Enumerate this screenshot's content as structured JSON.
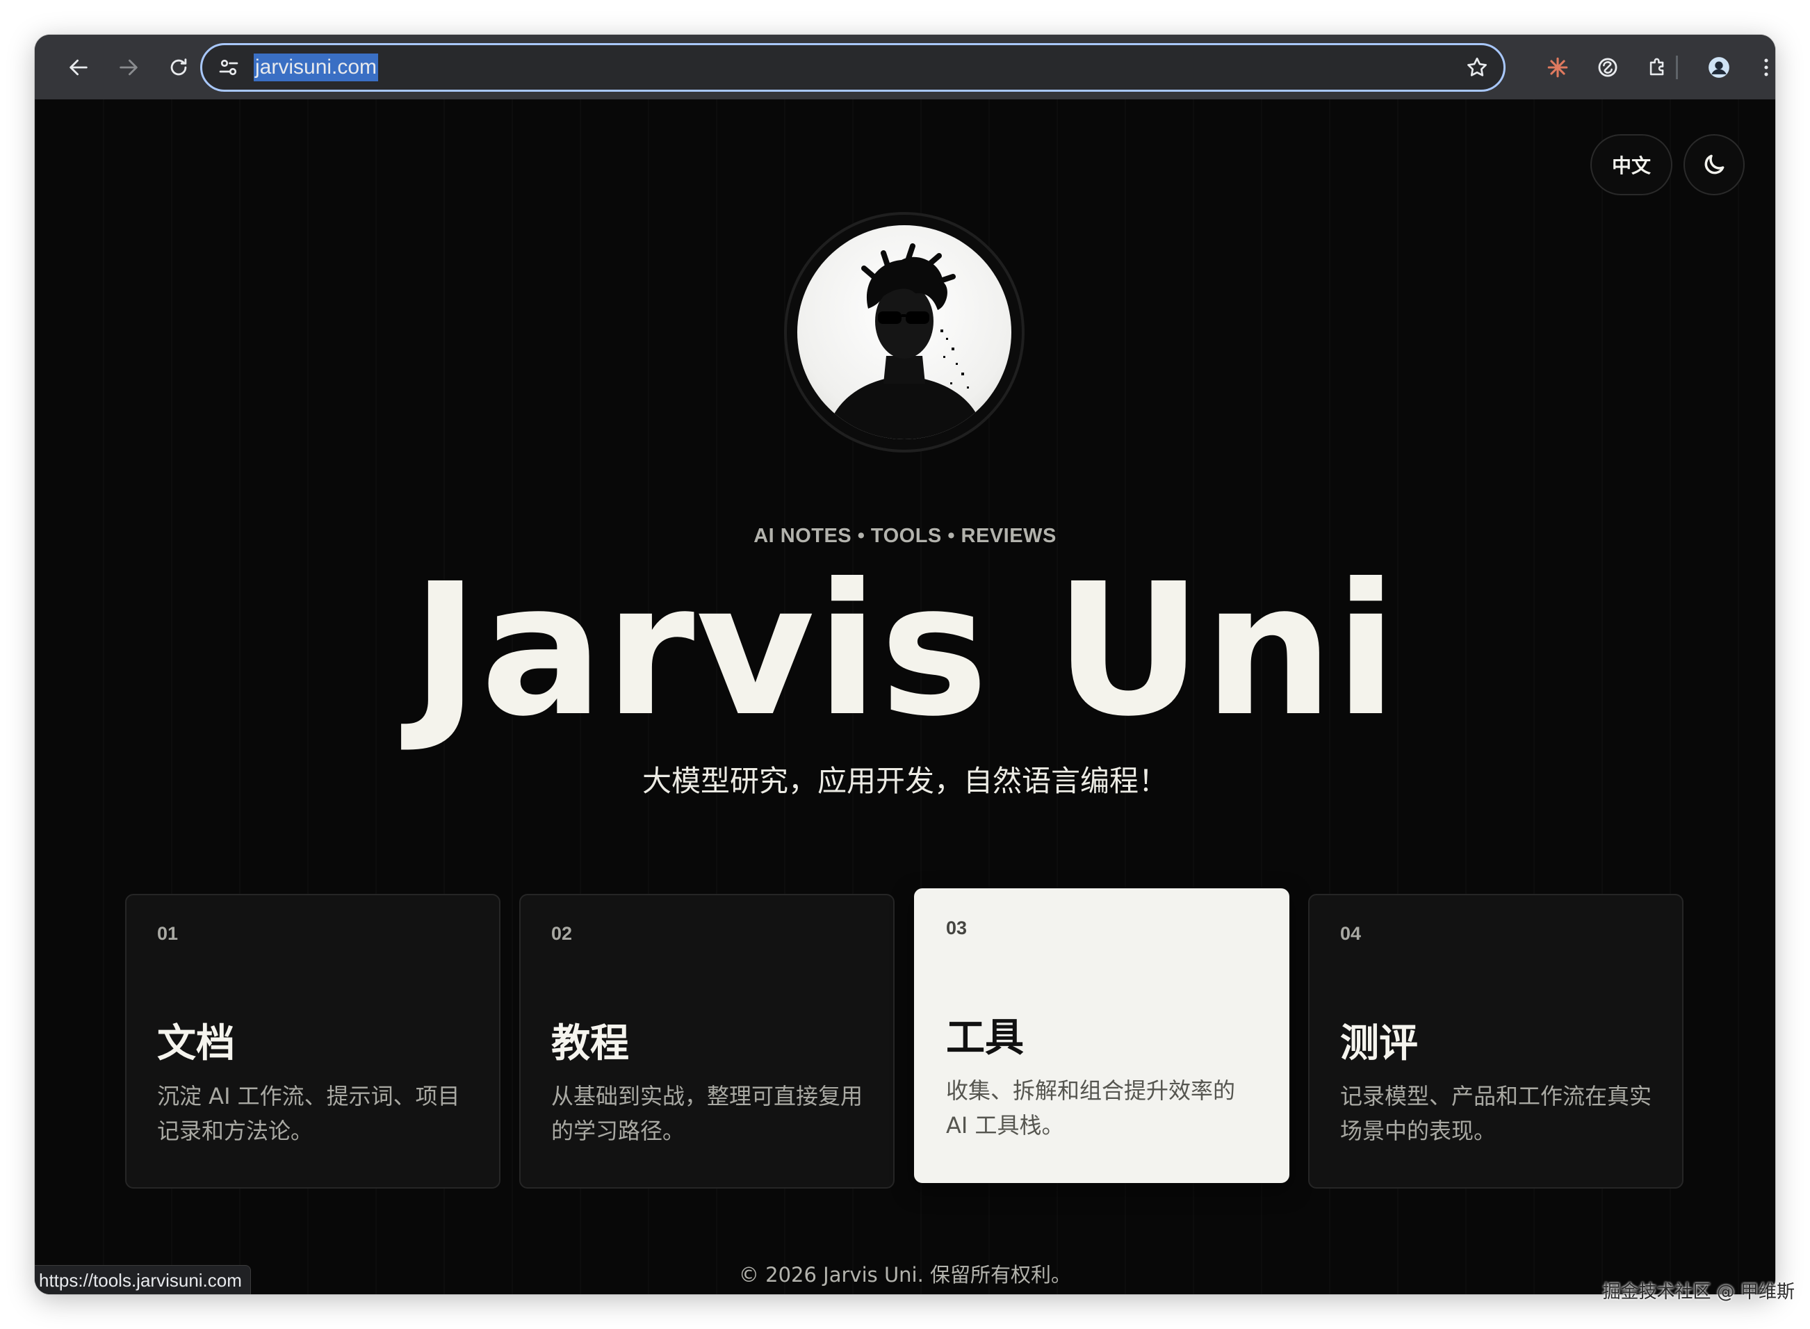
{
  "browser": {
    "url": "jarvisuni.com",
    "status_url": "https://tools.jarvisuni.com"
  },
  "header": {
    "language_toggle_label": "中文"
  },
  "hero": {
    "eyebrow": "AI NOTES • TOOLS • REVIEWS",
    "title": "Jarvis Uni",
    "tagline": "大模型研究，应用开发，自然语言编程！"
  },
  "cards": [
    {
      "number": "01",
      "title": "文档",
      "description": "沉淀 AI 工作流、提示词、项目记录和方法论。"
    },
    {
      "number": "02",
      "title": "教程",
      "description": "从基础到实战，整理可直接复用的学习路径。"
    },
    {
      "number": "03",
      "title": "工具",
      "description": "收集、拆解和组合提升效率的 AI 工具栈。",
      "active": true
    },
    {
      "number": "04",
      "title": "测评",
      "description": "记录模型、产品和工作流在真实场景中的表现。"
    }
  ],
  "footer": {
    "copyright": "© 2026 Jarvis Uni. 保留所有权利。"
  },
  "watermark": "掘金技术社区 @ 甲维斯",
  "colors": {
    "page_bg": "#080808",
    "toolbar_bg": "#35363a",
    "omnibox_focus": "#a8c7fa",
    "active_card_bg": "#f3f3ef",
    "extension_accent": "#e07a5f"
  }
}
